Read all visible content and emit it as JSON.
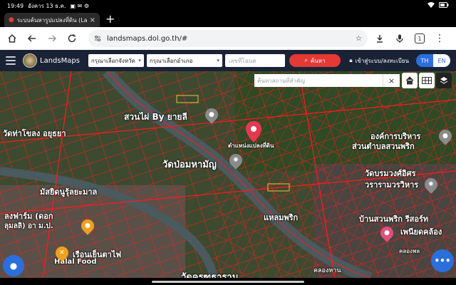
{
  "status_bar": {
    "time": "19:49",
    "date": "อังคาร 13 ธ.ค.",
    "indicators": "▣ ✉ ⚙",
    "battery_icon": "battery-icon"
  },
  "browser": {
    "tab_title": "ระบบค้นหารูปแปลงที่ดิน (Land",
    "tab_close": "×",
    "new_tab": "+",
    "url": "landsmaps.dol.go.th/#",
    "tab_count": "1"
  },
  "header": {
    "brand": "LandsMaps",
    "province_select": "กรุณาเลือกจังหวัด",
    "district_select": "กรุณาเลือกอำเภอ",
    "deed_input_placeholder": "เลขที่โฉนด",
    "search_button": "ค้นหา",
    "login": "เข้าสู่ระบบ/ลงทะเบียน",
    "lang_th": "TH",
    "lang_en": "EN"
  },
  "map": {
    "place_search_placeholder": "ค้นหาสถานที่สำคัญ",
    "place_search_clear": "×",
    "pin_label": "ตำแหน่งแปลงที่ดิน",
    "labels": [
      "สวนไผ่ By ยายลี",
      "วัดท่าโขลง อยุธยา",
      "องค์การบริหาร",
      "ส่วนตำบลสวนพริก",
      "วัดป่อมหามัญ",
      "มัสยิดนูรุ้ลยะมาล",
      "วัดบรมวงศ์อิศร",
      "วรารามวรวิหาร",
      "ลงฟาร์ม (ดอก",
      "ลุมลลิ) อา ม.ป.",
      "แหลมพริก",
      "บ้านสวนพริก รีสอร์ท",
      "เพนียดคล้อง",
      "เรือนเย็นตาไฟ",
      "Halal Food",
      "วัดครุฑธาราม",
      "คลองหาน",
      "คลองพล"
    ],
    "colors": {
      "parcel_line": "#ff1a1a",
      "river": "#4a5a5e",
      "fab": "#2a6fdb",
      "accent_red": "#e53935"
    }
  }
}
